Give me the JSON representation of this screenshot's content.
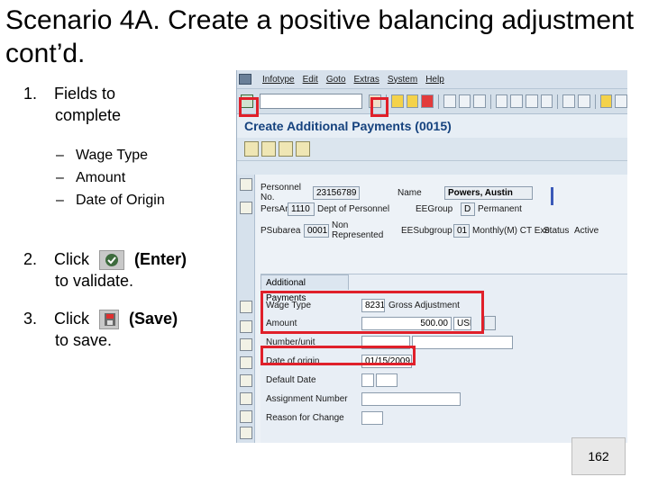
{
  "slide": {
    "title": "Scenario 4A. Create a positive balancing adjustment  cont’d.",
    "step1_num": "1.",
    "step1_line1": "Fields to",
    "step1_line2": "complete",
    "sub_items": [
      "Wage Type",
      "Amount",
      "Date of Origin"
    ],
    "sub_dash": "–",
    "step2_num": "2.",
    "step2_click": "Click",
    "step2_action": "(Enter)",
    "step2_line2": "to validate.",
    "step3_num": "3.",
    "step3_click": "Click",
    "step3_action": "(Save)",
    "step3_line2": "to save.",
    "page_number": "162"
  },
  "sap": {
    "menu": [
      "Infotype",
      "Edit",
      "Goto",
      "Extras",
      "System",
      "Help"
    ],
    "screen_title": "Create Additional Payments (0015)",
    "header": {
      "personnel_no_label": "Personnel No.",
      "personnel_no": "23156789",
      "name_label": "Name",
      "name": "Powers, Austin",
      "pers_area_label": "PersArea",
      "pers_area_code": "1110",
      "pers_area_text": "Dept of Personnel",
      "ee_group_label": "EEGroup",
      "ee_group_code": "D",
      "ee_group_text": "Permanent",
      "psubarea_label": "PSubarea",
      "psubarea_code": "0001",
      "psubarea_text": "Non Represented",
      "ee_subgroup_label": "EESubgroup",
      "ee_subgroup_code": "01",
      "ee_subgroup_text": "Monthly(M) CT Exe.",
      "status_label": "Status",
      "status_value": "Active"
    },
    "tab_label": "Additional Payments",
    "form": {
      "wage_type_label": "Wage Type",
      "wage_type_code": "8231",
      "wage_type_text": "Gross Adjustment",
      "amount_label": "Amount",
      "amount_value": "500.00",
      "currency": "USD",
      "number_unit_label": "Number/unit",
      "date_of_origin_label": "Date of origin",
      "date_of_origin_value": "01/15/2009",
      "default_date_label": "Default Date",
      "assignment_number_label": "Assignment Number",
      "reason_label": "Reason for Change"
    }
  },
  "colors": {
    "highlight": "#e0202a",
    "title_blue": "#15427e"
  }
}
